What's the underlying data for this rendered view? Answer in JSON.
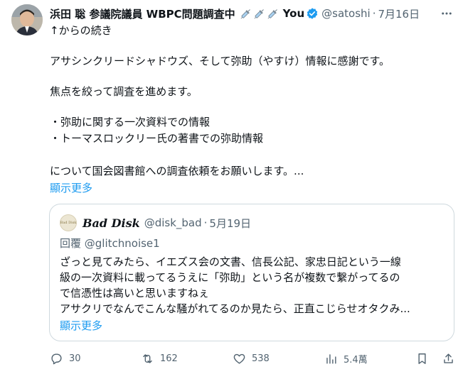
{
  "author": {
    "display_name": "浜田 聡 参議院議員 WBPC問題調査中",
    "name_tail": "You",
    "handle": "@satoshi",
    "date": "7月16日"
  },
  "tweet": {
    "lines": [
      "↑からの続き",
      "アサシンクリードシャドウズ、そして弥助（やすけ）情報に感謝です。",
      "焦点を絞って調査を進めます。",
      "・弥助に関する一次資料での情報",
      "・トーマスロックリー氏の著書での弥助情報",
      "について国会図書館への調査依頼をお願いします。..."
    ],
    "show_more": "顯示更多"
  },
  "quote": {
    "avatar_text": "Bad Disk",
    "name": "Bad Disk",
    "handle": "@disk_bad",
    "date": "5月19日",
    "reply_to": "回覆 @glitchnoise1",
    "lines": [
      "ざっと見てみたら、イエズス会の文書、信長公記、家忠日記という一線",
      "級の一次資料に載ってるうえに「弥助」という名が複数で繋がってるの",
      "で信憑性は高いと思いますねぇ",
      "アサクリでなんでこんな騒がれてるのか見たら、正直こじらせオタクみ..."
    ],
    "show_more": "顯示更多"
  },
  "actions": {
    "replies": "30",
    "reposts": "162",
    "likes": "538",
    "views": "5.4萬"
  },
  "colors": {
    "accent": "#1d9bf0",
    "muted": "#536471",
    "border": "#cfd9de"
  }
}
